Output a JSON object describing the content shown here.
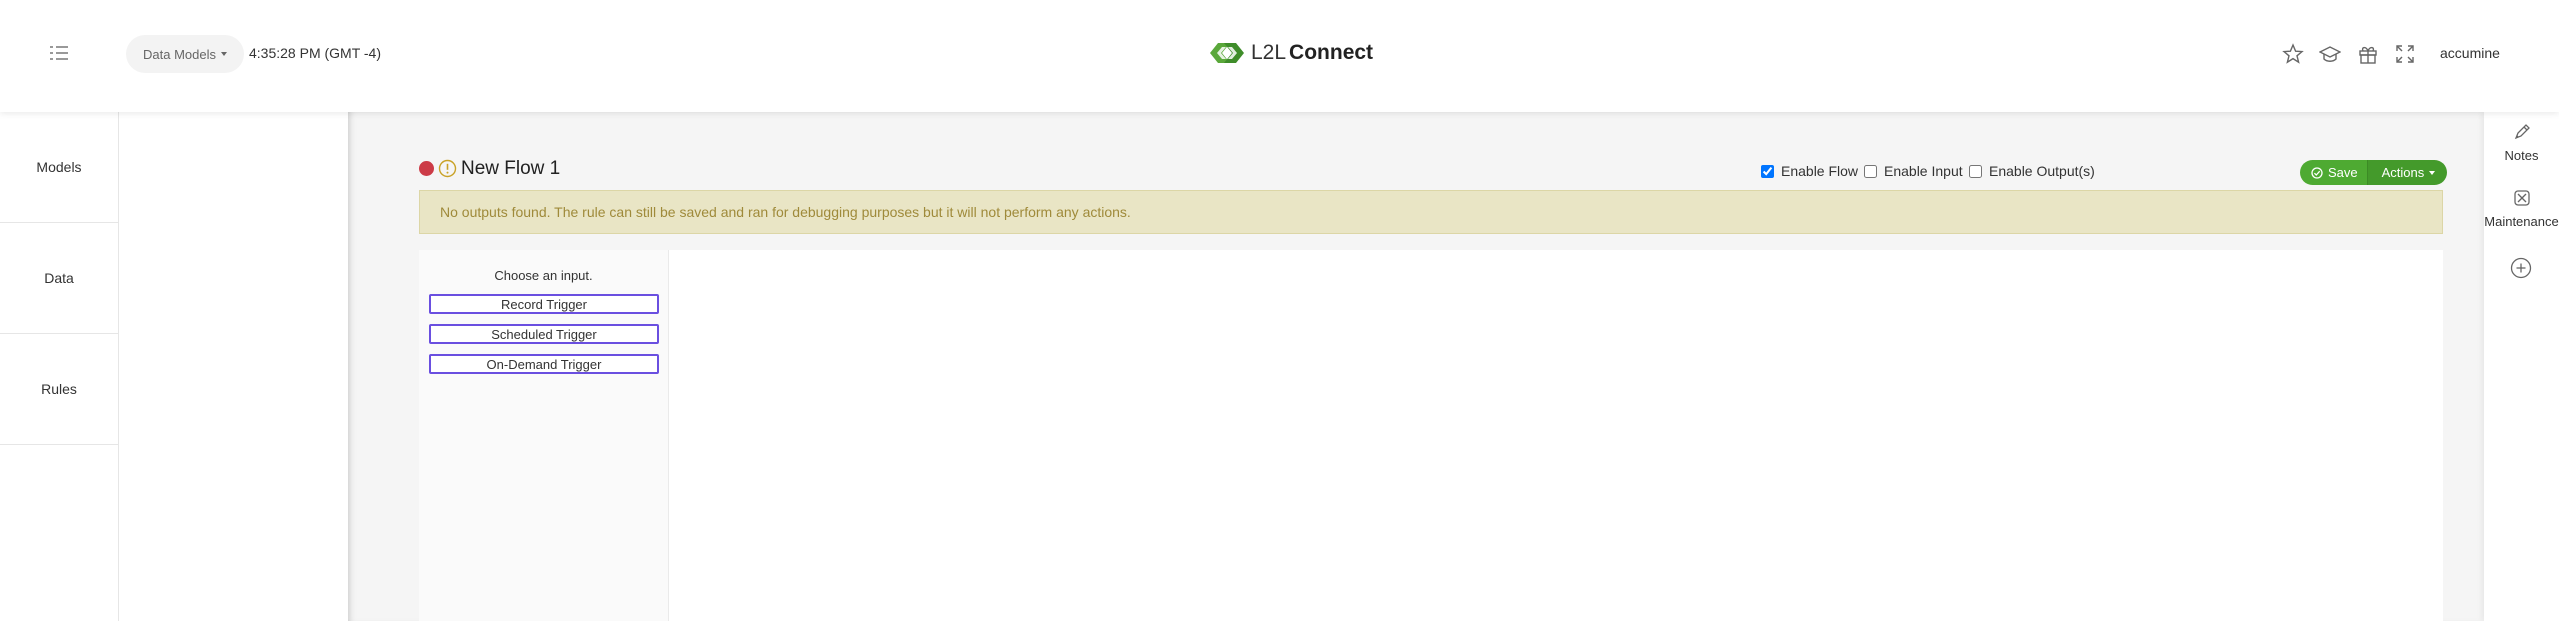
{
  "header": {
    "menu_icon": "list-menu-icon",
    "models_dropdown_label": "Data Models",
    "clock": "4:35:28 PM (GMT -4)",
    "logo": {
      "l2l": "L2L",
      "connect": "Connect",
      "icon": "l2l-chevrons-logo"
    },
    "icons": [
      "star-icon",
      "graduation-cap-icon",
      "gift-icon",
      "fullscreen-icon"
    ],
    "user": "accumine"
  },
  "leftnav": {
    "items": [
      {
        "label": "Models"
      },
      {
        "label": "Data"
      },
      {
        "label": "Rules"
      }
    ]
  },
  "flow": {
    "title": "New Flow 1",
    "status_color": "#cc3b47",
    "checkboxes": {
      "enable_flow": {
        "label": "Enable Flow",
        "checked": true
      },
      "enable_input": {
        "label": "Enable Input",
        "checked": false
      },
      "enable_outputs": {
        "label": "Enable Output(s)",
        "checked": false
      }
    },
    "save_label": "Save",
    "actions_label": "Actions",
    "alert": "No outputs found. The rule can still be saved and ran for debugging purposes but it will not perform any actions."
  },
  "inputs": {
    "heading": "Choose an input.",
    "triggers": [
      {
        "label": "Record Trigger"
      },
      {
        "label": "Scheduled Trigger"
      },
      {
        "label": "On-Demand Trigger"
      }
    ]
  },
  "rightrail": {
    "notes_label": "Notes",
    "maintenance_label": "Maintenance"
  },
  "colors": {
    "accent_green": "#4eaa32",
    "trigger_border": "#6a4fe0",
    "alert_bg": "#e9e5c5",
    "alert_text": "#9f8a3a"
  }
}
